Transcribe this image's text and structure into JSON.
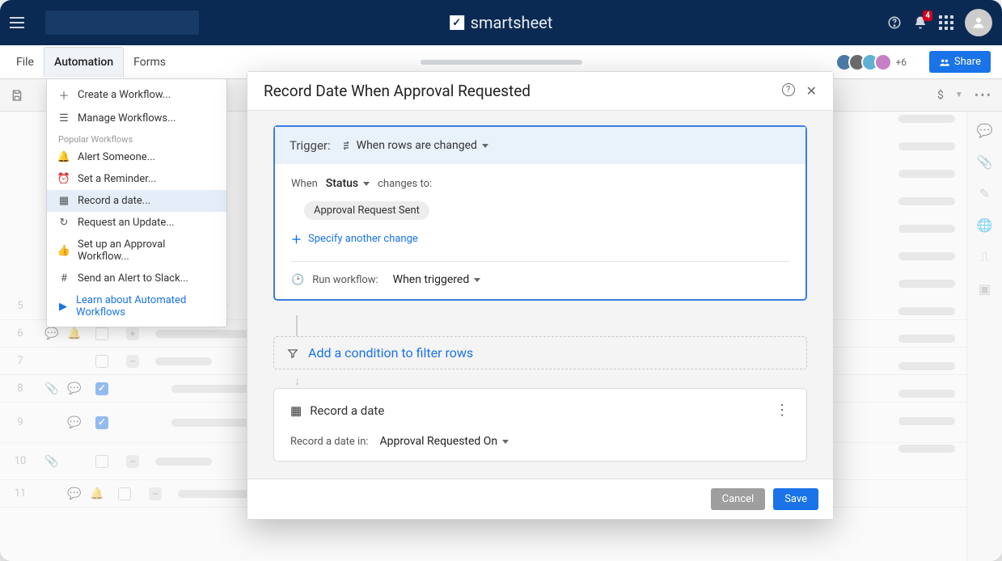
{
  "brand": "smartsheet",
  "notif_count": "4",
  "menubar": {
    "file": "File",
    "automation": "Automation",
    "forms": "Forms",
    "share": "Share",
    "plus_collab": "+6"
  },
  "dropdown": {
    "create": "Create a Workflow...",
    "manage": "Manage Workflows...",
    "popularHeader": "Popular Workflows",
    "alert": "Alert Someone...",
    "reminder": "Set a Reminder...",
    "record": "Record a date...",
    "request": "Request an Update...",
    "approval": "Set up an Approval Workflow...",
    "slack": "Send an Alert to Slack...",
    "learn": "Learn about Automated Workflows"
  },
  "modal": {
    "title": "Record Date When Approval Requested",
    "triggerLabel": "Trigger:",
    "triggerType": "When rows are changed",
    "when": "When",
    "field": "Status",
    "changesTo": "changes to:",
    "chipValue": "Approval Request Sent",
    "specify": "Specify another change",
    "runLabel": "Run workflow:",
    "runValue": "When triggered",
    "condition": "Add a condition to filter rows",
    "actionTitle": "Record a date",
    "actionLabel": "Record a date in:",
    "actionValue": "Approval Requested On",
    "cancel": "Cancel",
    "save": "Save"
  },
  "rows": [
    "5",
    "6",
    "7",
    "8",
    "9",
    "10",
    "11"
  ],
  "currency": "$"
}
